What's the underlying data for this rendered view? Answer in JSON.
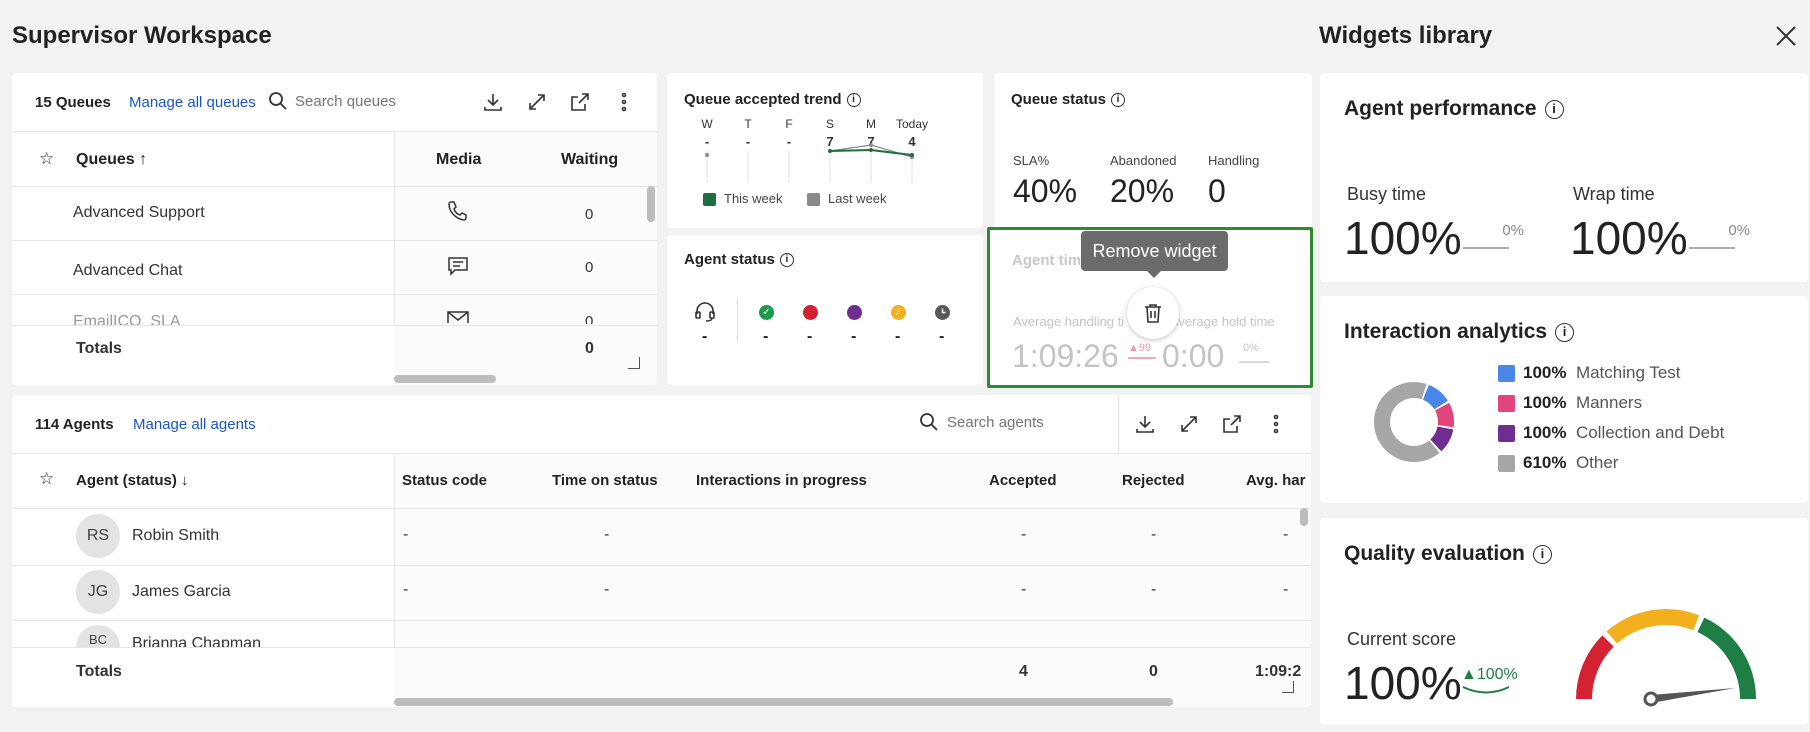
{
  "header": {
    "title": "Supervisor Workspace"
  },
  "library": {
    "title": "Widgets library",
    "close_icon": "close-icon"
  },
  "queues": {
    "count_label": "15 Queues",
    "manage_link": "Manage all queues",
    "search_placeholder": "Search queues",
    "columns": {
      "name": "Queues ↑",
      "media": "Media",
      "waiting": "Waiting"
    },
    "rows": [
      {
        "name": "Advanced Support",
        "media_icon": "phone-icon",
        "waiting": "0"
      },
      {
        "name": "Advanced Chat",
        "media_icon": "chat-icon",
        "waiting": "0"
      },
      {
        "name": "EmailICO_SLA",
        "media_icon": "mail-icon",
        "waiting": "0"
      }
    ],
    "totals_label": "Totals",
    "totals_waiting": "0"
  },
  "trend": {
    "title": "Queue accepted trend",
    "days": [
      "W",
      "T",
      "F",
      "S",
      "M",
      "Today"
    ],
    "values": [
      "-",
      "-",
      "-",
      "7",
      "7",
      "4"
    ],
    "legend_this": "This week",
    "legend_last": "Last week",
    "colors": {
      "this": "#1e6e3f",
      "last": "#8a8a8a"
    }
  },
  "queue_status": {
    "title": "Queue status",
    "labels": [
      "SLA%",
      "Abandoned",
      "Handling"
    ],
    "values": [
      "40%",
      "20%",
      "0"
    ]
  },
  "agent_status": {
    "title": "Agent status",
    "values": [
      "-",
      "-",
      "-",
      "-",
      "-",
      "-"
    ],
    "colors": [
      "#1b9a4a",
      "#d42232",
      "#6f2d91",
      "#f2b01e",
      "#5a5a5a"
    ]
  },
  "agent_time": {
    "title_partial": "Agent tim",
    "tooltip": "Remove widget",
    "label_aht": "Average handling ti",
    "label_hold": "Average hold time",
    "value_aht": "1:09:26",
    "delta_aht": "99",
    "value_hold": "0:00",
    "delta_hold": "0%",
    "highlight_color": "#2e8b2e"
  },
  "agents": {
    "count_label": "114 Agents",
    "manage_link": "Manage all agents",
    "search_placeholder": "Search agents",
    "columns": {
      "name": "Agent (status) ↓",
      "status_code": "Status code",
      "time_on_status": "Time on status",
      "in_progress": "Interactions in progress",
      "accepted": "Accepted",
      "rejected": "Rejected",
      "avg": "Avg. har"
    },
    "rows": [
      {
        "initials": "RS",
        "name": "Robin Smith",
        "status_code": "-",
        "time": "-",
        "accepted": "-",
        "rejected": "-",
        "avg": "-"
      },
      {
        "initials": "JG",
        "name": "James Garcia",
        "status_code": "-",
        "time": "-",
        "accepted": "-",
        "rejected": "-",
        "avg": "-"
      },
      {
        "initials": "BC",
        "name": "Brianna Chapman"
      }
    ],
    "totals_label": "Totals",
    "totals_accepted": "4",
    "totals_rejected": "0",
    "totals_avg": "1:09:2"
  },
  "agent_performance": {
    "title": "Agent performance",
    "busy_label": "Busy time",
    "busy_value": "100%",
    "busy_delta": "0%",
    "wrap_label": "Wrap time",
    "wrap_value": "100%",
    "wrap_delta": "0%"
  },
  "interaction_analytics": {
    "title": "Interaction analytics",
    "legend": [
      {
        "pct": "100%",
        "label": "Matching Test",
        "color": "#4a86e8"
      },
      {
        "pct": "100%",
        "label": "Manners",
        "color": "#e0457b"
      },
      {
        "pct": "100%",
        "label": "Collection and Debt",
        "color": "#6f2d91"
      },
      {
        "pct": "610%",
        "label": "Other",
        "color": "#a6a6a6"
      }
    ],
    "donut": [
      1,
      1,
      1,
      6.1
    ]
  },
  "quality": {
    "title": "Quality evaluation",
    "score_label": "Current score",
    "score_value": "100%",
    "delta": "100%",
    "gauge_level": 0.95,
    "gauge_colors": [
      "#d42232",
      "#f2b01e",
      "#1e7f45"
    ]
  }
}
